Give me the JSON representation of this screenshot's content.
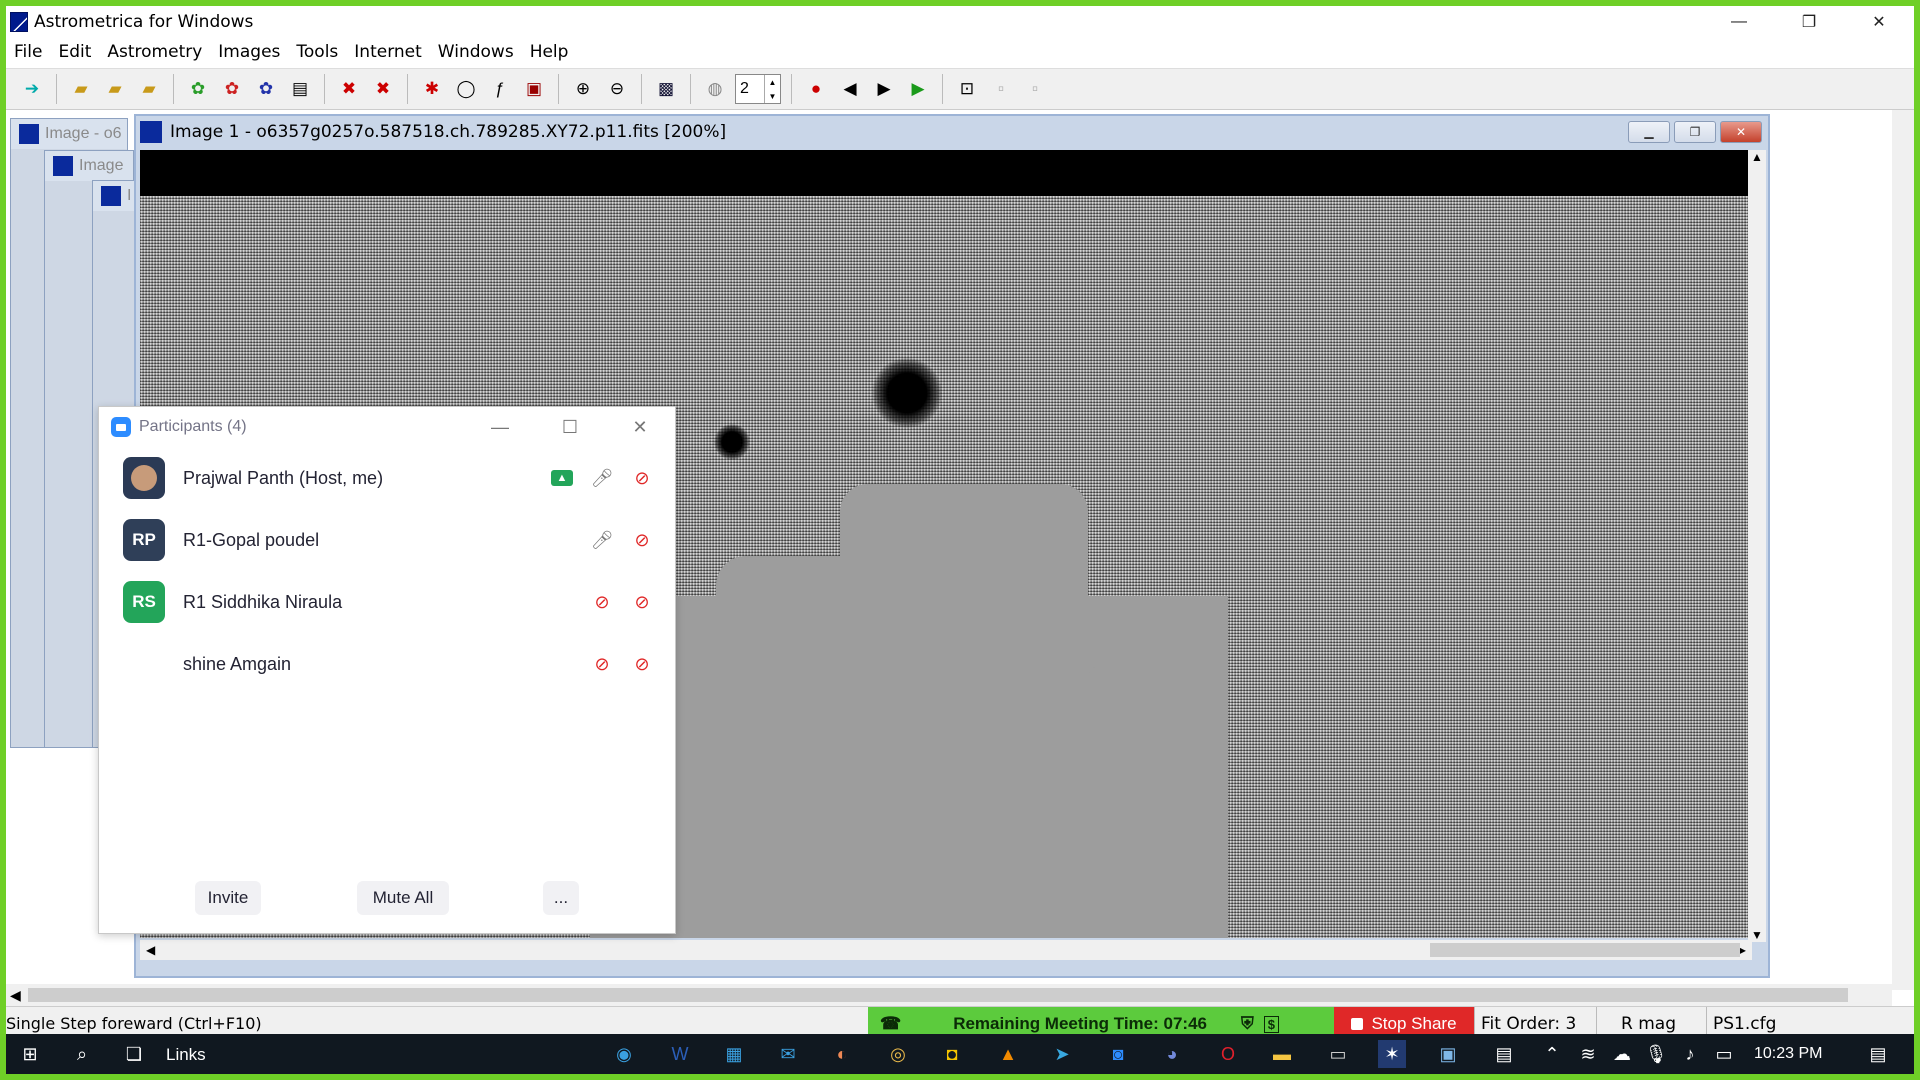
{
  "app": {
    "title": "Astrometrica for Windows",
    "window_controls": [
      "—",
      "❐",
      "✕"
    ]
  },
  "menu": [
    "File",
    "Edit",
    "Astrometry",
    "Images",
    "Tools",
    "Internet",
    "Windows",
    "Help"
  ],
  "toolbar": {
    "spin_value": "2"
  },
  "bg_windows": [
    {
      "title": "Image - o6"
    },
    {
      "title": "Image"
    },
    {
      "title": "I"
    }
  ],
  "image_window": {
    "title": "Image 1 - o6357g0257o.587518.ch.789285.XY72.p11.fits [200%]"
  },
  "participants": {
    "title": "Participants (4)",
    "list": [
      {
        "name": "Prajwal Panth (Host, me)",
        "initials": "",
        "avatar_color": "#2b3a55",
        "sharing": true,
        "mic_muted": false,
        "video_off": true
      },
      {
        "name": "R1-Gopal poudel",
        "initials": "RP",
        "avatar_color": "#2f3f58",
        "sharing": false,
        "mic_muted": false,
        "video_off": true
      },
      {
        "name": "R1 Siddhika Niraula",
        "initials": "RS",
        "avatar_color": "#23a55a",
        "sharing": false,
        "mic_muted": true,
        "video_off": true
      },
      {
        "name": "shine Amgain",
        "initials": "",
        "avatar_color": "#ffffff",
        "sharing": false,
        "mic_muted": true,
        "video_off": true
      }
    ],
    "buttons": {
      "invite": "Invite",
      "mute_all": "Mute All",
      "more": "..."
    }
  },
  "status": {
    "hint": "Single Step foreward (Ctrl+F10)",
    "meeting_time": "Remaining Meeting Time: 07:46",
    "stop_share": "Stop Share",
    "fit_order": "Fit Order: 3",
    "mag": "R mag",
    "cfg": "PS1.cfg"
  },
  "taskbar": {
    "search_label": "Links",
    "clock": "10:23 PM"
  },
  "colors": {
    "share_border": "#6fcf27",
    "meeting_bar": "#5ccb3d",
    "stop_share": "#e02828"
  }
}
